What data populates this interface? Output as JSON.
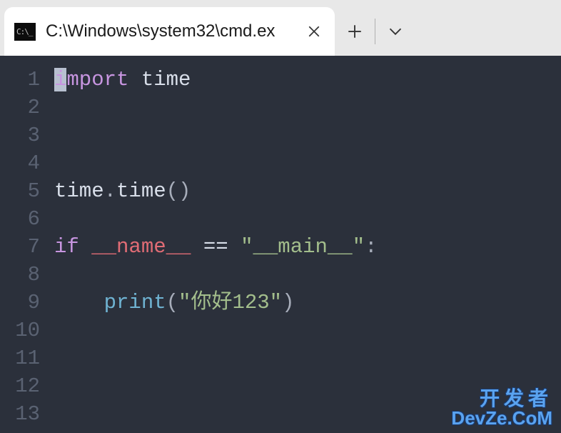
{
  "tab": {
    "title": "C:\\Windows\\system32\\cmd.ex",
    "icon_label": "cmd-icon"
  },
  "line_numbers": [
    "1",
    "2",
    "3",
    "4",
    "5",
    "6",
    "7",
    "8",
    "9",
    "10",
    "11",
    "12",
    "13"
  ],
  "code": {
    "l1": {
      "kw": "import",
      "mod": "time",
      "cursor_char": "i",
      "after_cursor": "mport"
    },
    "l5": {
      "obj": "time",
      "dot": ".",
      "method": "time",
      "parens": "()"
    },
    "l7": {
      "kw": "if",
      "name": "__name__",
      "eq": "==",
      "str": "\"__main__\"",
      "colon": ":"
    },
    "l9": {
      "indent": "    ",
      "func": "print",
      "open": "(",
      "str": "\"你好123\"",
      "close": ")"
    }
  },
  "watermark": {
    "line1": "开发者",
    "line2": "DevZe.CoM"
  }
}
